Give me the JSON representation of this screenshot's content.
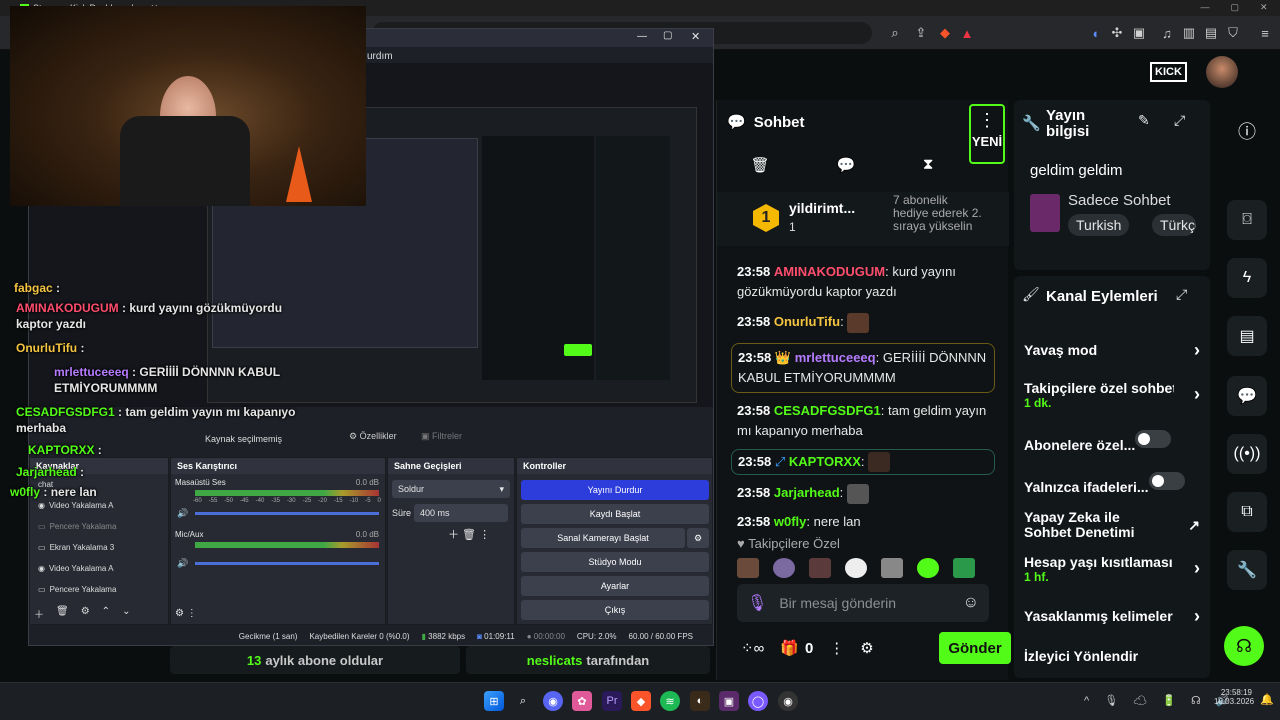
{
  "browser": {
    "tab_title": "Stream - Kick Dashboard"
  },
  "kick": {
    "logo": "KICK"
  },
  "chat": {
    "title": "Sohbet",
    "new_badge": "YENİ",
    "leader": {
      "name": "yildirimt...",
      "count": "1"
    },
    "gift_text": "7 abonelik hediye ederek 2. sıraya yükselin",
    "messages": [
      {
        "time": "23:58",
        "user": "AMINAKODUGUM",
        "text": "kurd yayını gözükmüyordu kaptor yazdı",
        "color": "#ff4d6d"
      },
      {
        "time": "23:58",
        "user": "OnurluTifu",
        "text": "",
        "color": "#f5c542"
      },
      {
        "time": "23:58",
        "user": "mrlettuceeeq",
        "text": "GERİİİİ DÖNNNN KABUL ETMİYORUMMMM",
        "color": "#b57cff"
      },
      {
        "time": "23:58",
        "user": "CESADFGSDFG1",
        "text": "tam geldim yayın mı kapanıyo merhaba",
        "color": "#53fc18"
      },
      {
        "time": "23:58",
        "user": "KAPTORXX",
        "text": "",
        "color": "#53fc18"
      },
      {
        "time": "23:58",
        "user": "Jarjarhead",
        "text": "",
        "color": "#53fc18"
      },
      {
        "time": "23:58",
        "user": "w0fly",
        "text": "nere lan",
        "color": "#53fc18"
      }
    ],
    "followers_only": "Takipçilere Özel",
    "input_placeholder": "Bir mesaj gönderin",
    "send_label": "Gönder",
    "gift_count": "0"
  },
  "stream_info": {
    "title": "Yayın bilgisi",
    "stream_title": "geldim geldim",
    "category": "Sadece Sohbet",
    "tags": [
      "Turkish",
      "Türkçe"
    ]
  },
  "channel_actions": {
    "title": "Kanal Eylemleri",
    "items": [
      {
        "label": "Yavaş mod",
        "sub": ""
      },
      {
        "label": "Takipçilere özel sohbet",
        "sub": "1 dk."
      },
      {
        "label": "Abonelere özel...",
        "sub": ""
      },
      {
        "label": "Yalnızca ifadeleri...",
        "sub": ""
      },
      {
        "label": "Yapay Zeka ile Sohbet Denetimi",
        "sub": ""
      },
      {
        "label": "Hesap yaşı kısıtlaması",
        "sub": "1 hf."
      },
      {
        "label": "Yasaklanmış kelimeler",
        "sub": ""
      },
      {
        "label": "İzleyici Yönlendir",
        "sub": ""
      }
    ]
  },
  "bottom_banner": {
    "subs": "13",
    "subs_text": "aylık abone oldular",
    "gifter": "neslicats",
    "gifter_text": "tarafından"
  },
  "obs": {
    "title_partial": "urdım",
    "no_source": "Kaynak seçilmemiş",
    "properties": "Özellikler",
    "filters": "Filtreler",
    "panels": {
      "sources": "Kaynaklar",
      "mixer": "Ses Karıştırıcı",
      "transitions": "Sahne Geçişleri",
      "controls": "Kontroller"
    },
    "sources": [
      "chat",
      "Video Yakalama A",
      "Pencere Yakalama",
      "Ekran Yakalama 3",
      "Video Yakalama A",
      "Pencere Yakalama"
    ],
    "mixer": [
      {
        "name": "Masaüstü Ses",
        "db": "0.0 dB"
      },
      {
        "name": "Mic/Aux",
        "db": "0.0 dB"
      }
    ],
    "mixer_ticks": [
      "-60",
      "-55",
      "-50",
      "-45",
      "-40",
      "-35",
      "-30",
      "-25",
      "-20",
      "-15",
      "-10",
      "-5",
      "0"
    ],
    "transition": "Soldur",
    "duration_label": "Süre",
    "duration": "400 ms",
    "controls": [
      "Yayını Durdur",
      "Kaydı Başlat",
      "Sanal Kamerayı Başlat",
      "Stüdyo Modu",
      "Ayarlar",
      "Çıkış"
    ],
    "status": {
      "delay": "Gecikme (1 san)",
      "dropped": "Kaybedilen Kareler 0 (%0.0)",
      "bitrate": "3882 kbps",
      "live": "01:09:11",
      "rec": "00:00:00",
      "cpu": "CPU: 2.0%",
      "fps": "60.00 / 60.00 FPS"
    }
  },
  "overlay_chat": [
    {
      "user": "fabgac",
      "text": "",
      "color": "#f5c542"
    },
    {
      "user": "AMINAKODUGUM",
      "text": "kurd yayını gözükmüyordu kaptor yazdı",
      "color": "#ff4d6d"
    },
    {
      "user": "OnurluTifu",
      "text": "",
      "color": "#f5c542"
    },
    {
      "user": "mrlettuceeeq",
      "text": "GERİİİİ DÖNNNN KABUL ETMİYORUMMMM",
      "color": "#b57cff"
    },
    {
      "user": "CESADFGSDFG1",
      "text": "tam geldim yayın mı kapanıyo merhaba",
      "color": "#53fc18"
    },
    {
      "user": "KAPTORXX",
      "text": "",
      "color": "#53fc18"
    },
    {
      "user": "Jarjarhead",
      "text": "",
      "color": "#53fc18"
    },
    {
      "user": "w0fly",
      "text": "nere lan",
      "color": "#53fc18"
    }
  ],
  "taskbar": {
    "time": "23:58:19",
    "date": "10.03.2026"
  },
  "colors": {
    "kick_green": "#53fc18",
    "accent_blue": "#2d3ddb"
  }
}
